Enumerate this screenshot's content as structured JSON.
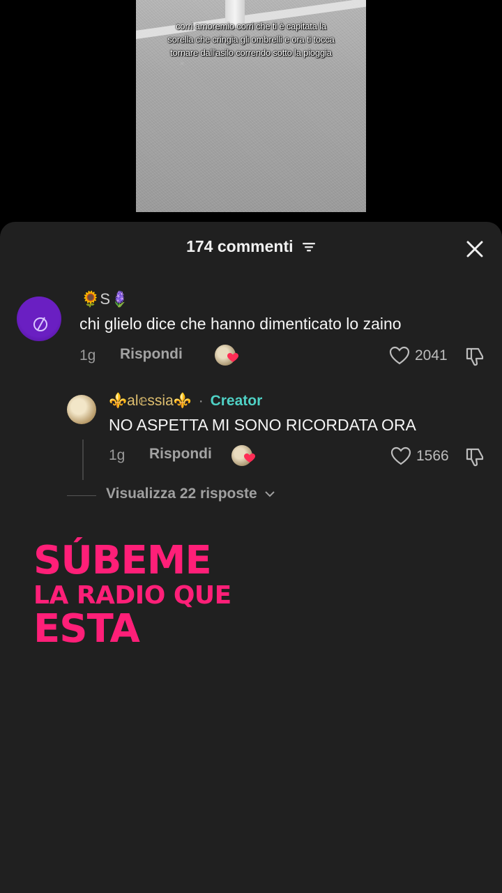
{
  "video": {
    "caption": "corri amoremio corri che ti è capitata la sorella che cringia gli ombrelli e ora ti tocca tornare dall'asilo correndo sotto la pioggia"
  },
  "comments_header": {
    "title": "174 commenti",
    "filter_icon": "filter-icon",
    "close_icon": "close-icon"
  },
  "comments": [
    {
      "username": "🌻S🪻",
      "text": "chi glielo dice che hanno dimenticato lo zaino",
      "time": "1g",
      "reply_label": "Rispondi",
      "likes": "2041"
    }
  ],
  "reply": {
    "username": "⚜️al𝕖ssia⚜️",
    "separator": "·",
    "badge": "Creator",
    "text": "NO ASPETTA MI SONO RICORDATA ORA",
    "time": "1g",
    "reply_label": "Rispondi",
    "likes": "1566"
  },
  "view_replies": "Visualizza 22 risposte",
  "promo": {
    "line1": "SÚBEME",
    "line2": "LA RADIO QUE",
    "line3": "ESTA"
  },
  "colors": {
    "sheet_bg": "#202020",
    "creator": "#4fd1c5",
    "promo": "#ff1f78"
  }
}
